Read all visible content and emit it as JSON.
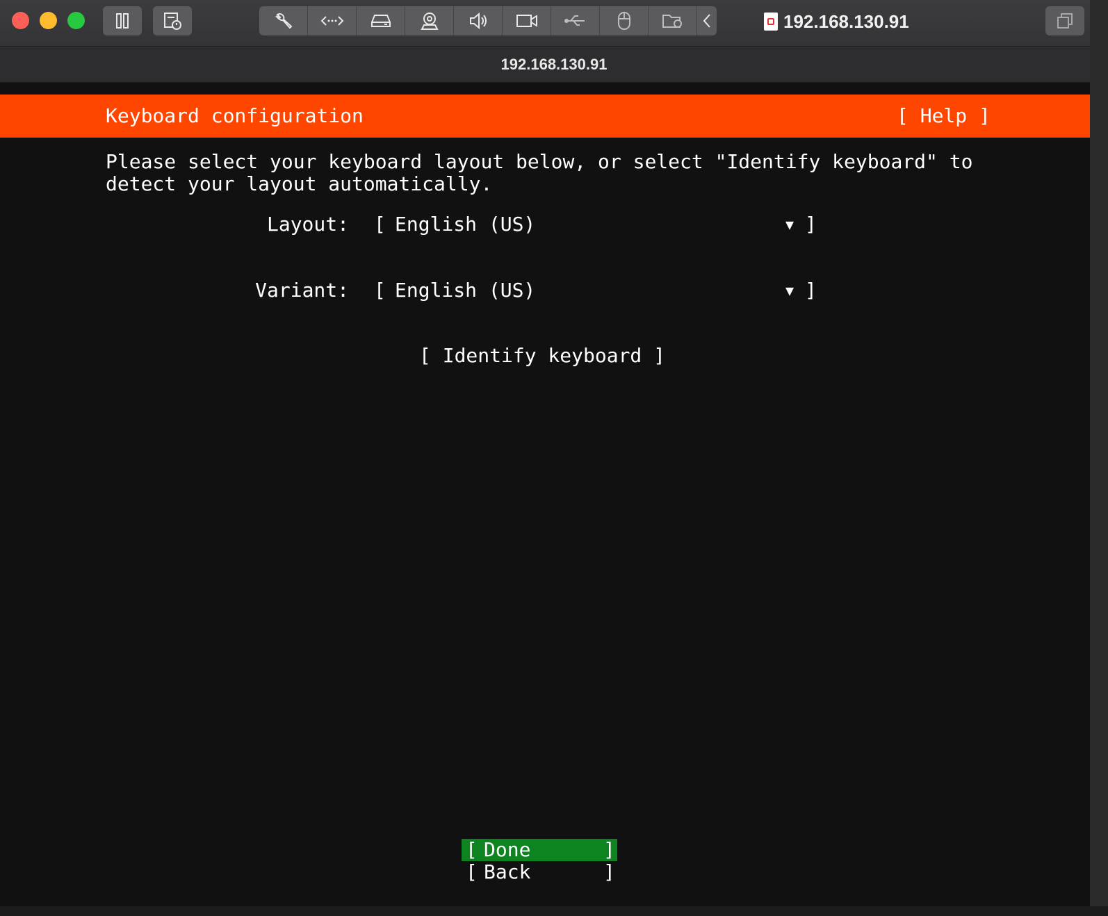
{
  "window": {
    "title": "192.168.130.91",
    "address": "192.168.130.91",
    "toolbar_icons": [
      "pause-icon",
      "snapshot-icon",
      "settings-wrench-icon",
      "network-icon",
      "hard-disk-icon",
      "camera-icon",
      "sound-icon",
      "video-camera-icon",
      "usb-icon",
      "mouse-icon",
      "shared-folder-icon",
      "chevron-left-icon",
      "window-icon"
    ]
  },
  "installer": {
    "header_title": "Keyboard configuration",
    "help_label": "[ Help ]",
    "intro_line1": "Please select your keyboard layout below, or select \"Identify keyboard\" to",
    "intro_line2": "detect your layout automatically.",
    "layout": {
      "label": "Layout:",
      "value": "English (US)"
    },
    "variant": {
      "label": "Variant:",
      "value": "English (US)"
    },
    "dropdown_open": "[",
    "dropdown_close": "]",
    "dropdown_arrow": "▼",
    "identify_label": "[ Identify keyboard ]",
    "done": {
      "open": "[",
      "label": "Done",
      "close": "]"
    },
    "back": {
      "open": "[",
      "label": "Back",
      "close": "]"
    }
  },
  "colors": {
    "header": "#fe4600",
    "done_highlight": "#0e8420",
    "background": "#111111"
  }
}
